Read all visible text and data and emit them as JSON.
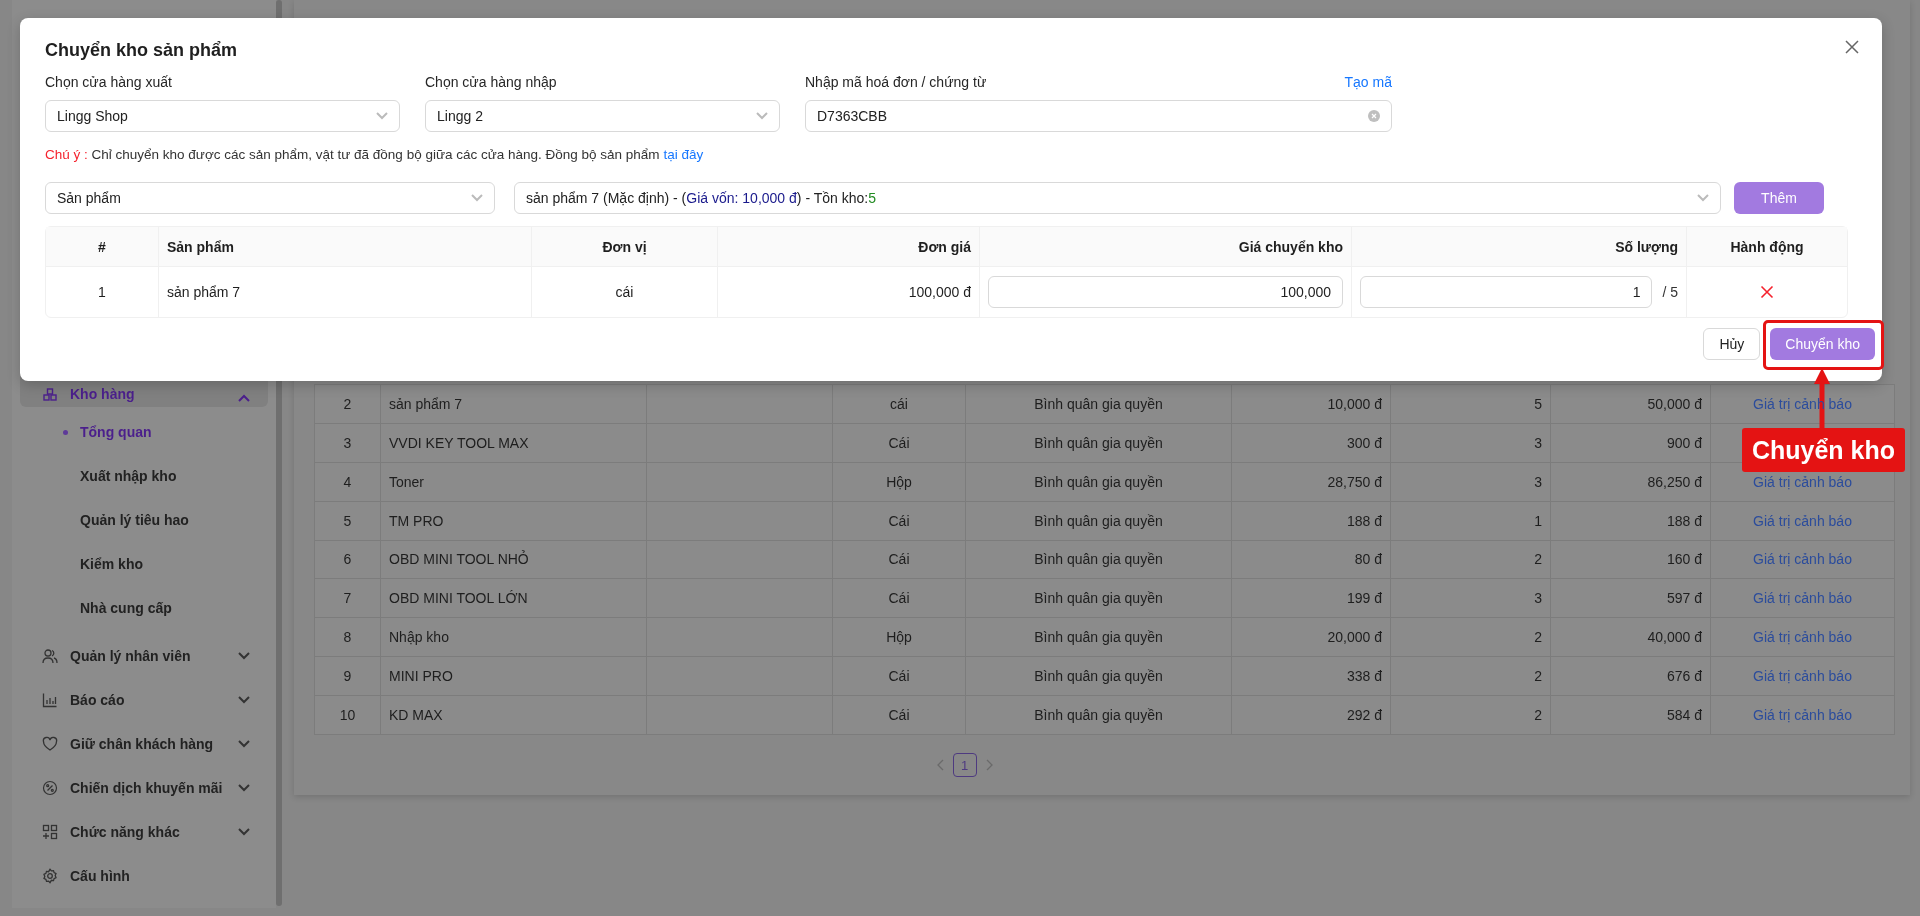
{
  "sidebar": {
    "items": [
      {
        "label": "Kho hàng",
        "expanded": true,
        "selected": true,
        "children": [
          {
            "label": "Tổng quan",
            "selected": true
          },
          {
            "label": "Xuất nhập kho",
            "selected": false
          },
          {
            "label": "Quản lý tiêu hao",
            "selected": false
          },
          {
            "label": "Kiểm kho",
            "selected": false
          },
          {
            "label": "Nhà cung cấp",
            "selected": false
          }
        ]
      },
      {
        "label": "Quản lý nhân viên",
        "expanded": false,
        "selected": false
      },
      {
        "label": "Báo cáo",
        "expanded": false,
        "selected": false
      },
      {
        "label": "Giữ chân khách hàng",
        "expanded": false,
        "selected": false
      },
      {
        "label": "Chiến dịch khuyến mãi",
        "expanded": false,
        "selected": false
      },
      {
        "label": "Chức năng khác",
        "expanded": false,
        "selected": false
      },
      {
        "label": "Cấu hình",
        "selected": false
      }
    ]
  },
  "inventory_table": {
    "rows": [
      {
        "index": "2",
        "name": "sản phẩm 7",
        "unit": "cái",
        "method": "Bình quân gia quyền",
        "unit_price": "10,000 đ",
        "quantity": "5",
        "total": "50,000 đ",
        "action": "Giá trị cảnh báo"
      },
      {
        "index": "3",
        "name": "VVDI KEY TOOL MAX",
        "unit": "Cái",
        "method": "Bình quân gia quyền",
        "unit_price": "300 đ",
        "quantity": "3",
        "total": "900 đ"
      },
      {
        "index": "4",
        "name": "Toner",
        "unit": "Hộp",
        "method": "Bình quân gia quyền",
        "unit_price": "28,750 đ",
        "quantity": "3",
        "total": "86,250 đ",
        "action": "Giá trị cảnh báo"
      },
      {
        "index": "5",
        "name": "TM PRO",
        "unit": "Cái",
        "method": "Bình quân gia quyền",
        "unit_price": "188 đ",
        "quantity": "1",
        "total": "188 đ",
        "action": "Giá trị cảnh báo"
      },
      {
        "index": "6",
        "name": "OBD MINI TOOL NHỎ",
        "unit": "Cái",
        "method": "Bình quân gia quyền",
        "unit_price": "80 đ",
        "quantity": "2",
        "total": "160 đ",
        "action": "Giá trị cảnh báo"
      },
      {
        "index": "7",
        "name": "OBD MINI TOOL LỚN",
        "unit": "Cái",
        "method": "Bình quân gia quyền",
        "unit_price": "199 đ",
        "quantity": "3",
        "total": "597 đ",
        "action": "Giá trị cảnh báo"
      },
      {
        "index": "8",
        "name": "Nhập kho",
        "unit": "Hộp",
        "method": "Bình quân gia quyền",
        "unit_price": "20,000 đ",
        "quantity": "2",
        "total": "40,000 đ",
        "action": "Giá trị cảnh báo"
      },
      {
        "index": "9",
        "name": "MINI PRO",
        "unit": "Cái",
        "method": "Bình quân gia quyền",
        "unit_price": "338 đ",
        "quantity": "2",
        "total": "676 đ",
        "action": "Giá trị cảnh báo"
      },
      {
        "index": "10",
        "name": "KD MAX",
        "unit": "Cái",
        "method": "Bình quân gia quyền",
        "unit_price": "292 đ",
        "quantity": "2",
        "total": "584 đ",
        "action": "Giá trị cảnh báo"
      }
    ]
  },
  "pagination": {
    "pages": [
      {
        "label": "1",
        "selected": true
      }
    ]
  },
  "modal": {
    "title": "Chuyển kho sản phẩm",
    "fields": [
      {
        "kind": "select",
        "label": "Chọn cửa hàng xuất",
        "value": "Lingg Shop"
      },
      {
        "kind": "select",
        "label": "Chọn cửa hàng nhập",
        "value": "Lingg 2"
      },
      {
        "kind": "input",
        "label": "Nhập mã hoá đơn / chứng từ",
        "value": "D7363CBB",
        "action": "Tạo mã"
      }
    ],
    "note": {
      "warning": "Chú ý :",
      "text": "Chỉ chuyển kho được các sản phẩm, vật tư đã đồng bộ giữa các cửa hàng. Đồng bộ sản phẩm",
      "link": "tại đây"
    },
    "picker": {
      "type_select": "Sản phẩm",
      "product_parts": [
        {
          "kind": "plain",
          "text": "sản phẩm 7 (Mặc định)  - ("
        },
        {
          "kind": "cost",
          "text": "Giá vốn: 10,000 đ"
        },
        {
          "kind": "plain",
          "text": ")  - Tồn kho:"
        },
        {
          "kind": "stock",
          "text": "5"
        }
      ],
      "add_button": "Thêm"
    },
    "table": {
      "columns": [
        "#",
        "Sản phẩm",
        "Đơn vị",
        "Đơn giá",
        "Giá chuyển kho",
        "Số lượng",
        "Hành động"
      ],
      "rows": [
        {
          "index": "1",
          "name": "sản phẩm 7",
          "unit": "cái",
          "unit_price": "100,000 đ",
          "transfer_price": "100,000",
          "quantity": "1",
          "stock": "/ 5"
        }
      ]
    },
    "buttons": [
      {
        "kind": "default",
        "label": "Hủy"
      },
      {
        "kind": "primary",
        "label": "Chuyển kho"
      }
    ]
  },
  "annotation": {
    "label": "Chuyển kho"
  }
}
